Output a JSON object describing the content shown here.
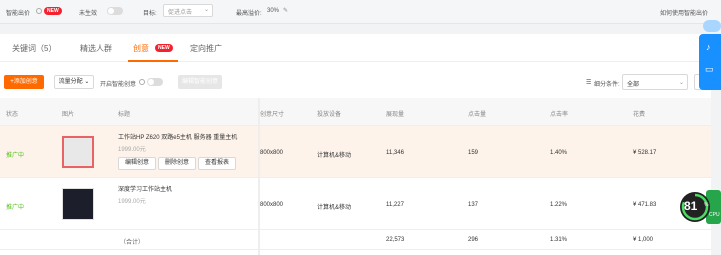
{
  "topbar": {
    "smart_bid": "智能出价",
    "new_badge": "NEW",
    "not_effective": "未生效",
    "target_label": "目标:",
    "target_placeholder": "促进点击",
    "max_premium_label": "最高溢价:",
    "max_premium_value": "30%",
    "help_link": "如何使用智能出价"
  },
  "tabs": [
    {
      "label": "关键词（5）"
    },
    {
      "label": "精选人群"
    },
    {
      "label": "创意"
    },
    {
      "label": "定向推广"
    }
  ],
  "tab_new_badge": "NEW",
  "toolbar": {
    "add_creative": "+添加创意",
    "traffic_alloc": "流量分配",
    "smart_creative": "开启智能创意",
    "smart_creative_btn": "编辑智能创意",
    "detail_cond": "细分条件:",
    "detail_select": "全部"
  },
  "table": {
    "headers": [
      "状态",
      "图片",
      "标题",
      "创意尺寸",
      "投放设备",
      "展现量",
      "点击量",
      "点击率",
      "花费"
    ],
    "rows": [
      {
        "status": "推广中",
        "title": "工作站HP Z620 双路e5主机 服务器 重量主机",
        "price": "1999.00元",
        "buttons": [
          "编辑创意",
          "删除创意",
          "查看报表"
        ],
        "size": "800x800",
        "device": "计算机&移动",
        "impressions": "11,346",
        "clicks": "159",
        "ctr": "1.40%",
        "cost": "¥ 528.17"
      },
      {
        "status": "推广中",
        "title": "深度学习工作站主机",
        "price": "1999.00元",
        "buttons": [],
        "size": "800x800",
        "device": "计算机&移动",
        "impressions": "11,227",
        "clicks": "137",
        "ctr": "1.22%",
        "cost": "¥ 471.83"
      }
    ],
    "total": {
      "label": "（合计）",
      "impressions": "22,573",
      "clicks": "296",
      "ctr": "1.31%",
      "cost": "¥ 1,000"
    }
  },
  "gauge": {
    "value": "81",
    "unit": "%",
    "label": "CPU"
  },
  "colors": {
    "accent": "#ff6a00",
    "status": "#52c41a",
    "float": "#1890ff"
  }
}
